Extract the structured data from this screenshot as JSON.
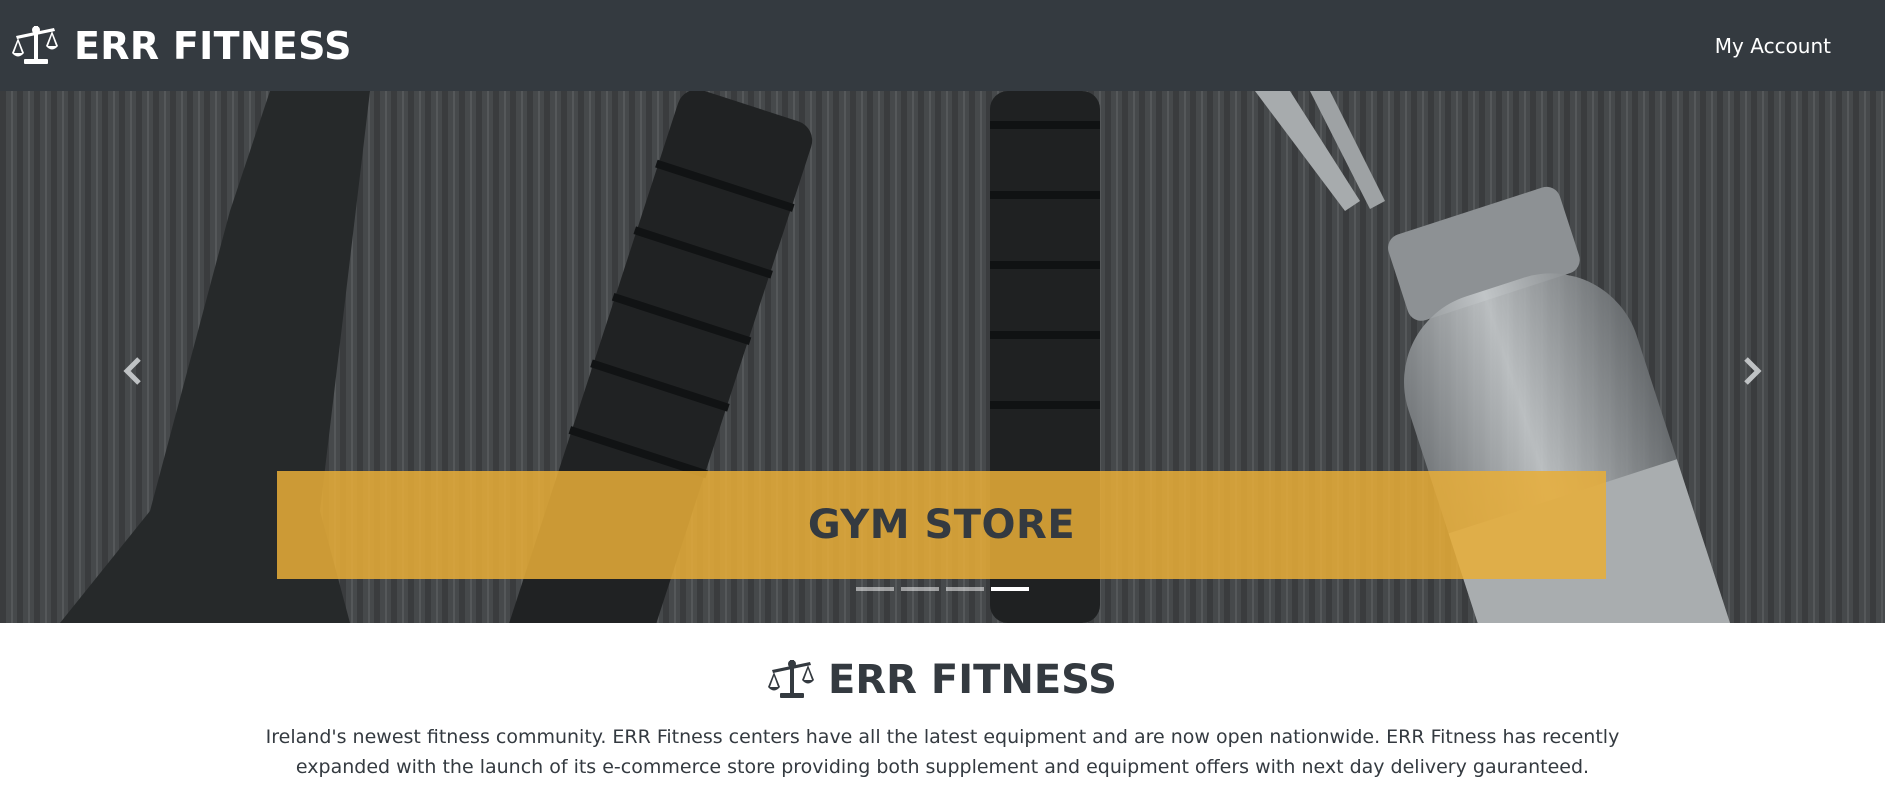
{
  "navbar": {
    "brand_icon": "balance-scale-icon",
    "brand_name": "ERR FITNESS",
    "account_link": "My Account"
  },
  "carousel": {
    "image_description_icon": "gym-equipment-photo",
    "caption": "GYM STORE",
    "prev_icon": "chevron-left-icon",
    "next_icon": "chevron-right-icon",
    "slide_count": 4,
    "active_slide": 4,
    "caption_color": "#e8ad38"
  },
  "about": {
    "icon": "balance-scale-icon",
    "heading": "ERR FITNESS",
    "text": "Ireland's newest fitness community. ERR Fitness centers have all the latest equipment and are now open nationwide. ERR Fitness has recently expanded with the launch of its e-commerce store providing both supplement and equipment offers with next day delivery gauranteed."
  },
  "colors": {
    "navbar_bg": "#343a40",
    "accent": "#e8ad38"
  }
}
